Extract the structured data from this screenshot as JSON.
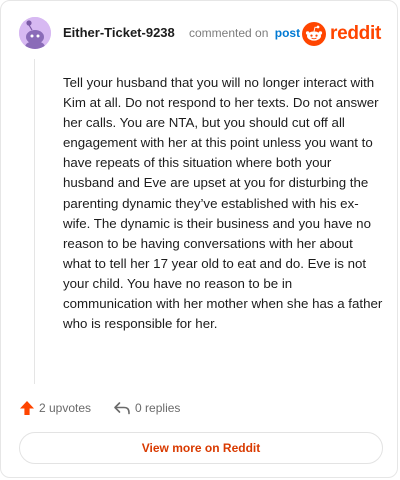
{
  "comment": {
    "author": "Either-Ticket-9238",
    "action_text": "commented on",
    "post_link": "post",
    "body": "Tell your husband that you will no longer interact with Kim at all. Do not respond to her texts. Do not answer her calls. You are NTA, but you should cut off all engagement with her at this point unless you want to have repeats of this situation where both your husband and Eve are upset at you for disturbing the parenting dynamic they’ve established with his ex-wife. The dynamic is their business and you have no reason to be having conversations with her about what to tell her 17 year old to eat and do. Eve is not your child. You have no reason to be in communication with her mother when she has a father who is responsible for her."
  },
  "brand": {
    "name": "reddit",
    "icon": "reddit-logo-icon"
  },
  "footer": {
    "upvotes": "2 upvotes",
    "replies": "0 replies",
    "view_more": "View more on Reddit"
  },
  "colors": {
    "brand": "#ff4500",
    "link": "#0079d3",
    "view_more": "#d93a00",
    "avatar_bg": "#d7b9f2"
  }
}
